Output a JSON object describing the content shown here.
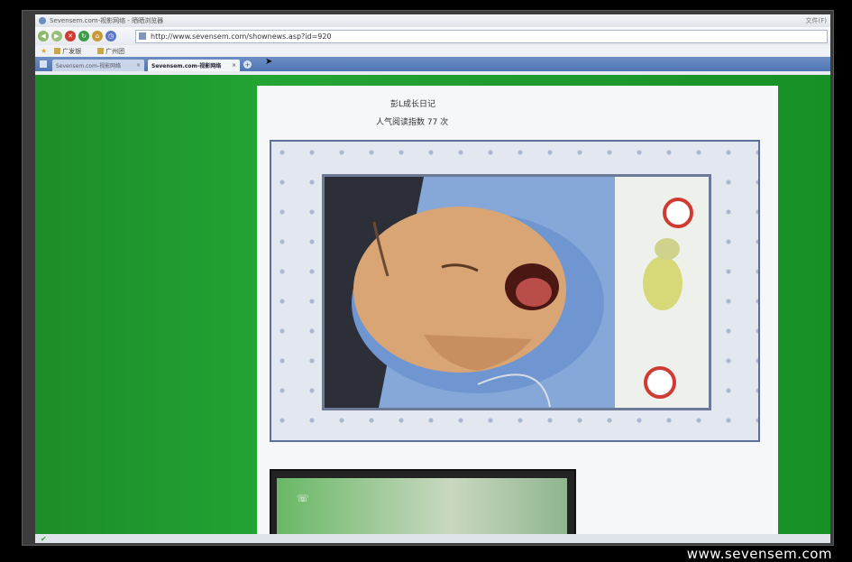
{
  "browser": {
    "window_title": "Sevensem.com-视影网络 - 晒晒浏览器",
    "menu_label": "文件(F)",
    "url": "http://www.sevensem.com/shownews.asp?id=920",
    "favorites": [
      "广发银",
      "广州团"
    ],
    "tabs": [
      {
        "label": "Sevensem.com-视影网络",
        "active": false
      },
      {
        "label": "Sevensem.com-视影网络",
        "active": true
      }
    ],
    "icons": {
      "back": "back-arrow-icon",
      "forward": "forward-arrow-icon",
      "stop": "stop-icon",
      "refresh": "refresh-icon",
      "home": "home-icon",
      "history": "history-icon",
      "new_tab": "plus-icon",
      "status": "check-icon"
    }
  },
  "article": {
    "title": "彭L成长日记",
    "read_count": "人气阅读指数 77 次"
  },
  "colors": {
    "page_background": "#1f9a2e",
    "panel_background": "#f6f7f9",
    "photo_border": "#5e6f9a"
  },
  "watermark": "www.sevensem.com"
}
